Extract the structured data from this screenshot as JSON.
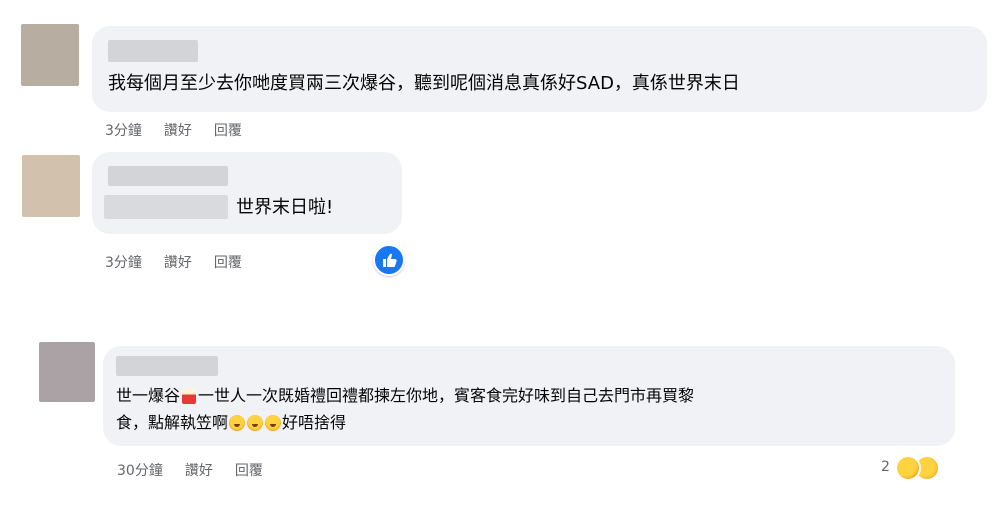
{
  "comments": [
    {
      "text": "我每個月至少去你哋度買兩三次爆谷，聽到呢個消息真係好SAD，真係世界末日",
      "time": "3分鐘",
      "like_label": "讚好",
      "reply_label": "回覆"
    },
    {
      "text": "世界末日啦!",
      "time": "3分鐘",
      "like_label": "讚好",
      "reply_label": "回覆",
      "reaction_icon": "like-icon"
    },
    {
      "line1_a": "世一爆谷",
      "line1_b": "一世人一次既婚禮回禮都揀左你地，賓客食完好味到自己去門市再買黎",
      "line2_a": "食，點解執笠啊",
      "line2_b": "好唔捨得",
      "time": "30分鐘",
      "like_label": "讚好",
      "reply_label": "回覆",
      "reaction_count": "2",
      "reaction_icons": [
        "heart-face-icon",
        "sad-face-icon"
      ],
      "inline_icons": [
        "popcorn-icon",
        "crying-face-icon"
      ]
    }
  ],
  "colors": {
    "bubble": "#f0f2f5",
    "meta_text": "#65676b",
    "like_blue": "#1877f2"
  }
}
